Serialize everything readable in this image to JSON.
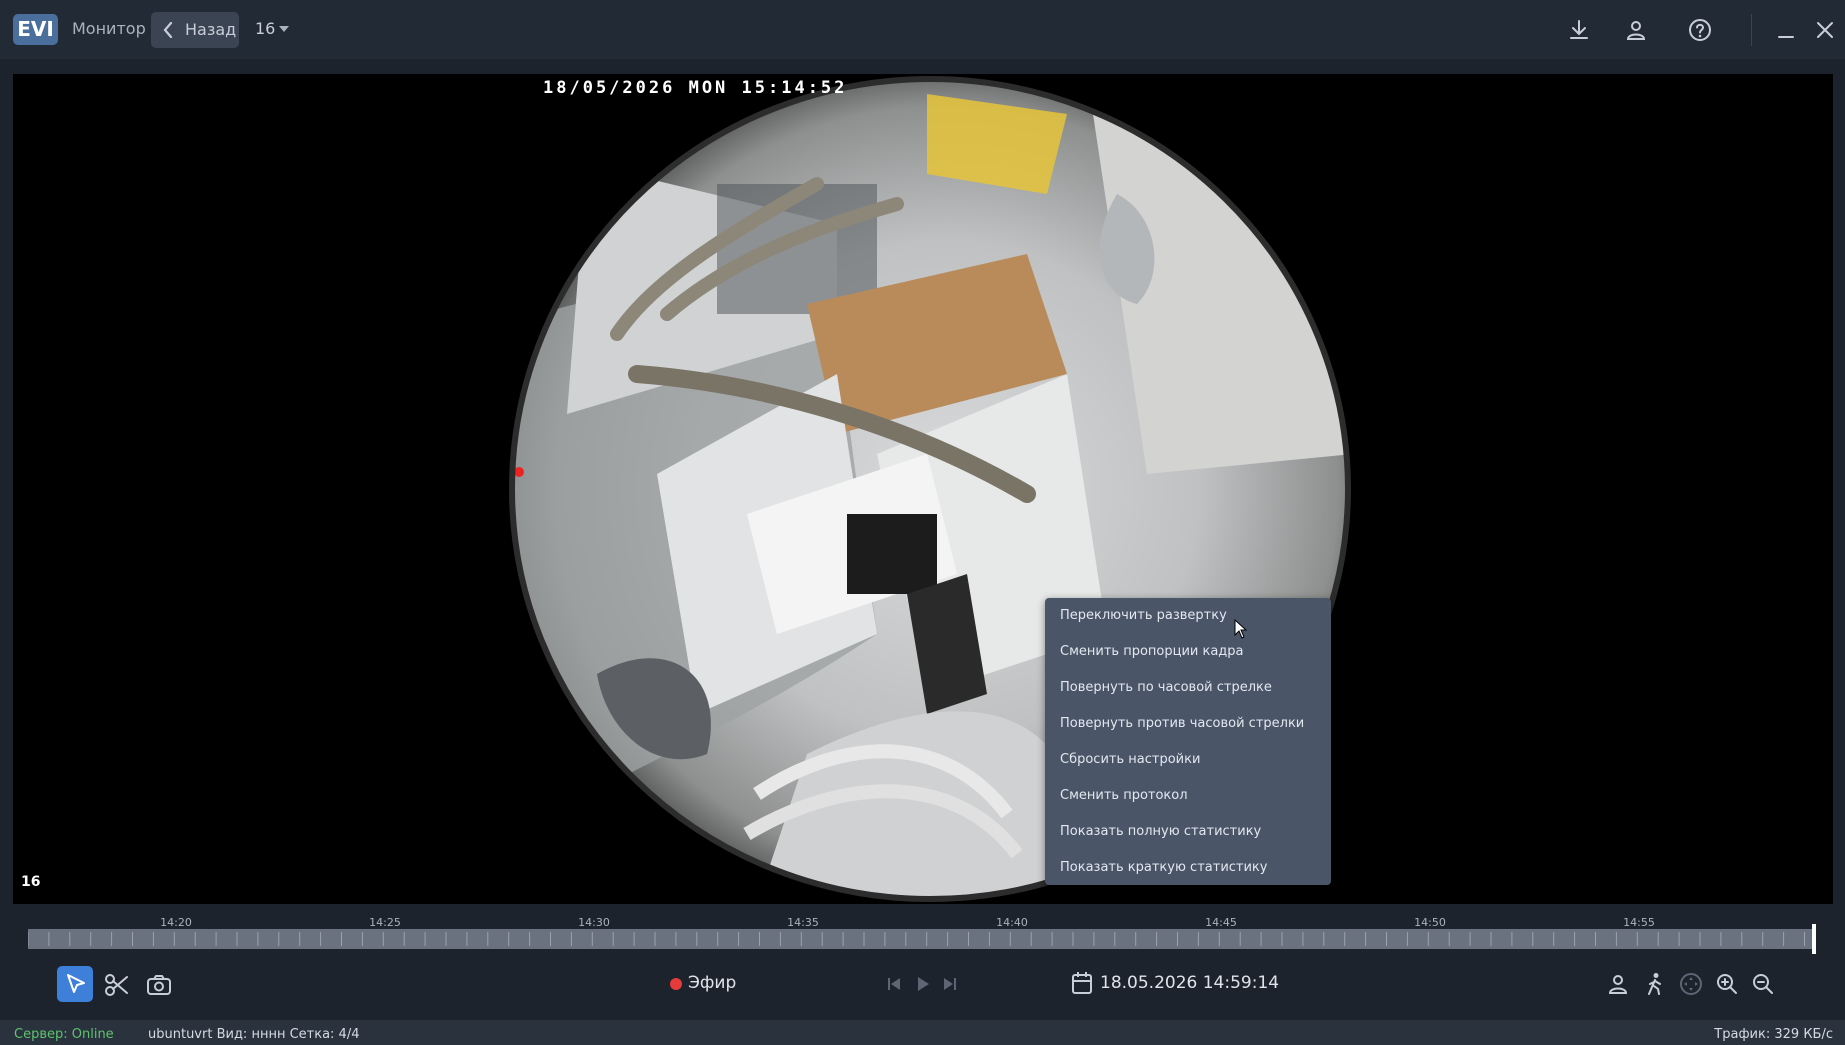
{
  "header": {
    "logo": "EVI",
    "nav_monitor": "Монитор",
    "back_label": "Назад",
    "grid_value": "16",
    "icons": [
      "download-icon",
      "user-icon",
      "help-icon",
      "minimize-icon",
      "close-icon"
    ]
  },
  "video": {
    "timestamp": "18/05/2026 MON 15:14:52",
    "camera_number": "16"
  },
  "context_menu": {
    "items": [
      "Переключить развертку",
      "Сменить пропорции кадра",
      "Повернуть по часовой стрелке",
      "Повернуть против часовой стрелки",
      "Сбросить настройки",
      "Сменить протокол",
      "Показать полную статистику",
      "Показать краткую статистику"
    ]
  },
  "timeline": {
    "labels": [
      "14:20",
      "14:25",
      "14:30",
      "14:35",
      "14:40",
      "14:45",
      "14:50",
      "14:55"
    ]
  },
  "toolbar": {
    "live_label": "Эфир",
    "datetime": "18.05.2026 14:59:14",
    "left_icons": [
      "pointer-icon",
      "scissors-icon",
      "camera-icon"
    ],
    "playback_icons": [
      "skip-back-icon",
      "play-icon",
      "skip-forward-icon"
    ],
    "right_icons": [
      "person-icon",
      "walking-icon",
      "ptz-icon",
      "zoom-in-icon",
      "zoom-out-icon"
    ],
    "colors": {
      "accent": "#3d7fd9",
      "live_dot": "#e53b3b",
      "online": "#5cc46b"
    }
  },
  "status": {
    "server": "Сервер: Online",
    "info": "ubuntuvrt  Вид: нннн  Сетка: 4/4",
    "traffic": "Трафик: 329 КБ/с"
  }
}
